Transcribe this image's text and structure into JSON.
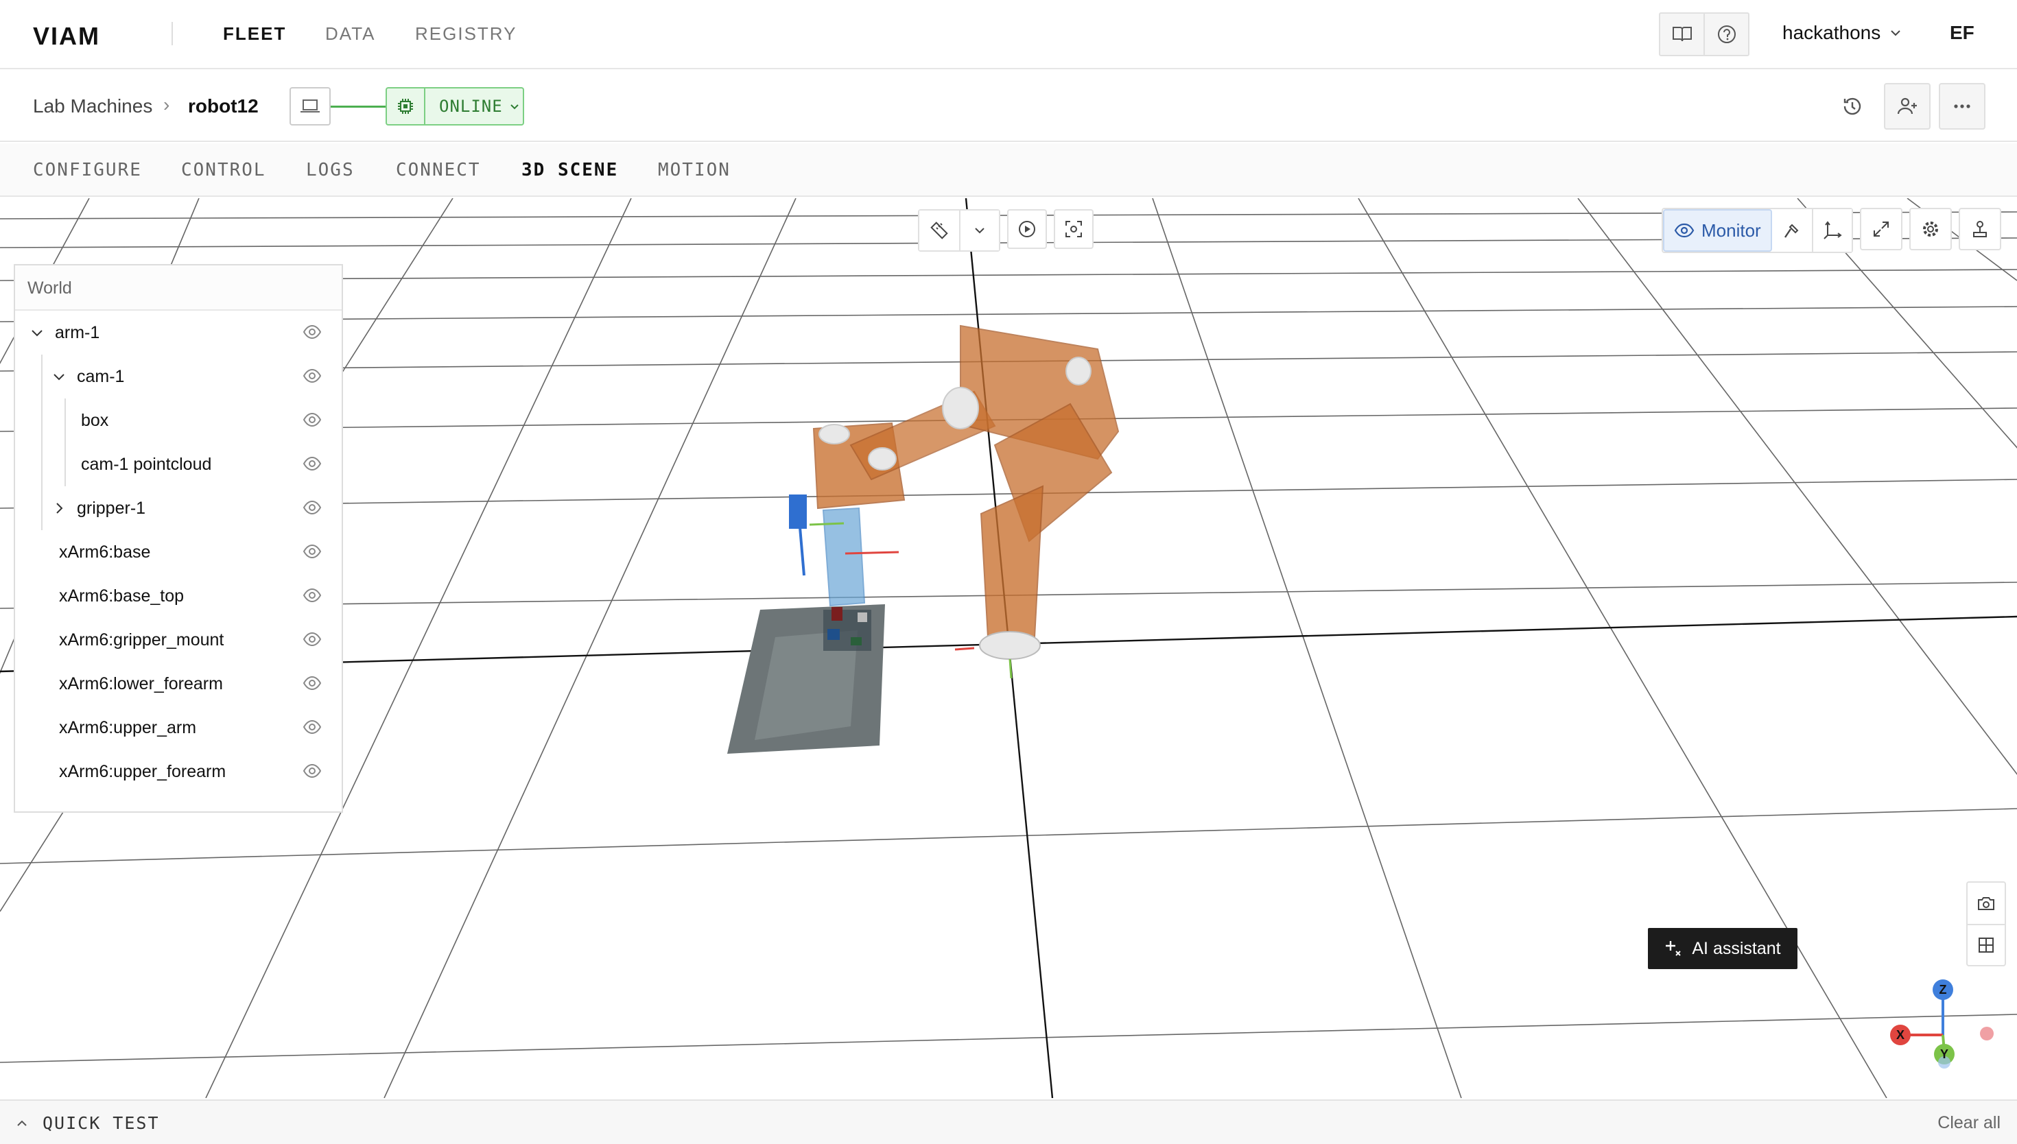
{
  "topbar": {
    "logo": "VIAM",
    "nav": [
      "FLEET",
      "DATA",
      "REGISTRY"
    ],
    "active_nav": "FLEET",
    "org_name": "hackathons",
    "user_initials": "EF"
  },
  "subheader": {
    "breadcrumb_parent": "Lab Machines",
    "breadcrumb_sep": "›",
    "machine_name": "robot12",
    "status_label": "ONLINE",
    "status_color": "#2e7d32"
  },
  "tabs": {
    "items": [
      "CONFIGURE",
      "CONTROL",
      "LOGS",
      "CONNECT",
      "3D SCENE",
      "MOTION"
    ],
    "active": "3D SCENE"
  },
  "tree": {
    "root_label": "World",
    "items": [
      {
        "label": "arm-1",
        "expanded": true
      },
      {
        "label": "cam-1",
        "expanded": true
      },
      {
        "label": "box"
      },
      {
        "label": "cam-1 pointcloud"
      },
      {
        "label": "gripper-1",
        "expanded": false
      },
      {
        "label": "xArm6:base"
      },
      {
        "label": "xArm6:base_top"
      },
      {
        "label": "xArm6:gripper_mount"
      },
      {
        "label": "xArm6:lower_forearm"
      },
      {
        "label": "xArm6:upper_arm"
      },
      {
        "label": "xArm6:upper_forearm"
      }
    ]
  },
  "scene_toolbar": {
    "monitor_label": "Monitor"
  },
  "ai_assistant_label": "AI assistant",
  "gizmo": {
    "x": "X",
    "y": "Y",
    "z": "Z",
    "x_color": "#e0453f",
    "y_color": "#7cc348",
    "z_color": "#3f7fdc"
  },
  "quick_test": {
    "label": "QUICK TEST",
    "clear_label": "Clear all"
  },
  "colors": {
    "accent": "#2b5aa8",
    "online_bg": "#e9f8ea",
    "arm": "#c8702f"
  }
}
